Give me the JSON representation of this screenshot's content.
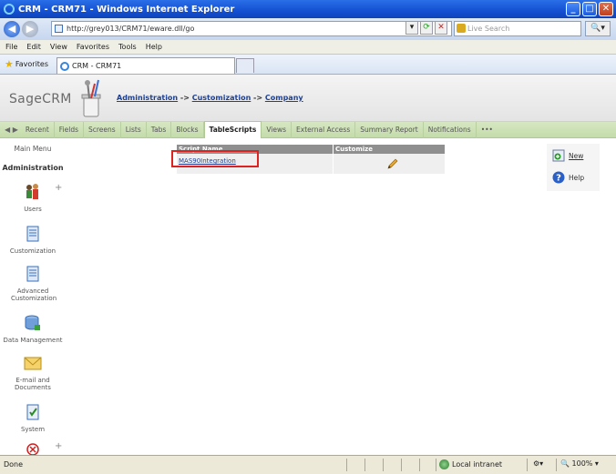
{
  "window": {
    "title": "CRM - CRM71     - Windows Internet Explorer"
  },
  "addressbar": {
    "url": "http://grey013/CRM71/eware.dll/go",
    "search_placeholder": "Live Search"
  },
  "menubar": {
    "items": [
      "File",
      "Edit",
      "View",
      "Favorites",
      "Tools",
      "Help"
    ]
  },
  "favbar": {
    "favorites_label": "Favorites",
    "tab_title": "CRM - CRM71"
  },
  "header": {
    "logo": "SageCRM",
    "breadcrumb": {
      "part1": "Administration",
      "sep1": " -> ",
      "part2": "Customization",
      "sep2": " -> ",
      "part3": "Company"
    }
  },
  "tabnav": {
    "tabs": [
      "Recent",
      "Fields",
      "Screens",
      "Lists",
      "Tabs",
      "Blocks",
      "TableScripts",
      "Views",
      "External Access",
      "Summary Report",
      "Notifications",
      "•••"
    ],
    "active_index": 6
  },
  "sidebar": {
    "main_menu": "Main Menu",
    "section": "Administration",
    "items": [
      "Users",
      "Customization",
      "Advanced Customization",
      "Data Management",
      "E-mail and Documents",
      "System"
    ]
  },
  "grid": {
    "columns": [
      "Script Name",
      "Customize"
    ],
    "rows": [
      {
        "script_name": "MAS90Integration"
      }
    ]
  },
  "actions": {
    "new_label": "New",
    "help_label": "Help"
  },
  "statusbar": {
    "status": "Done",
    "zone": "Local intranet",
    "zoom": "100%"
  },
  "colors": {
    "tab_bar": "#c4dbaa",
    "header_bg": "#8f8f8f",
    "highlight_border": "#dd2222",
    "link": "#1f3f8f"
  }
}
